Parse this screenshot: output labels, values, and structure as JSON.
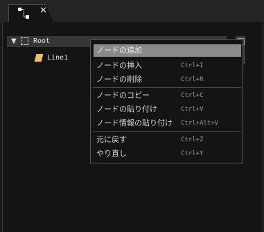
{
  "tab": {
    "close_glyph": "✕",
    "icon": "node-graph-icon"
  },
  "tree": {
    "root": {
      "expander": "▼",
      "label": "Root",
      "icon": "dashed-square-icon"
    },
    "child": {
      "label": "Line1",
      "icon": "line-object-icon",
      "icon_color": "#e8c070"
    }
  },
  "context_menu": {
    "items": [
      {
        "label": "ノードの追加",
        "shortcut": ""
      },
      {
        "label": "ノードの挿入",
        "shortcut": "Ctrl+I"
      },
      {
        "label": "ノードの削除",
        "shortcut": "Ctrl+R"
      },
      {
        "label": "ノードのコピー",
        "shortcut": "Ctrl+C"
      },
      {
        "label": "ノードの貼り付け",
        "shortcut": "Ctrl+V"
      },
      {
        "label": "ノード情報の貼り付け",
        "shortcut": "Ctrl+Alt+V"
      },
      {
        "label": "元に戻す",
        "shortcut": "Ctrl+Z"
      },
      {
        "label": "やり直し",
        "shortcut": "Ctrl+Y"
      }
    ],
    "highlight_color": "#8a8a8a"
  }
}
